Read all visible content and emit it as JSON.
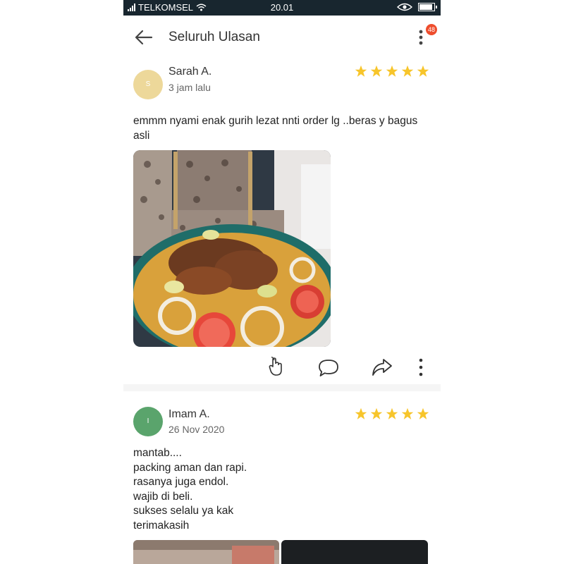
{
  "status": {
    "carrier": "TELKOMSEL",
    "time": "20.01",
    "battery_level": 0.9
  },
  "header": {
    "title": "Seluruh Ulasan",
    "badge": "48",
    "icons": [
      "back-arrow-icon",
      "more-vertical-icon"
    ]
  },
  "reviews": [
    {
      "avatar_letter": "S",
      "name": "Sarah A.",
      "time": "3 jam lalu",
      "rating": 5,
      "text": "emmm nyami enak gurih lezat nnti order lg ..beras y bagus asli",
      "avatar_color": "#edd89a"
    },
    {
      "avatar_letter": "I",
      "name": "Imam A.",
      "time": "26 Nov 2020",
      "rating": 5,
      "text": "mantab....\npacking aman dan rapi.\nrasanya juga endol.\nwajib di beli.\nsukses selalu ya kak\nterimakasih",
      "avatar_color": "#5aa46c"
    }
  ],
  "actions": [
    "like-hand-icon",
    "comment-icon",
    "share-icon",
    "more-vertical-icon"
  ],
  "colors": {
    "star": "#f7c52b",
    "badge": "#ee4d2d",
    "statusbar": "#18262f"
  }
}
